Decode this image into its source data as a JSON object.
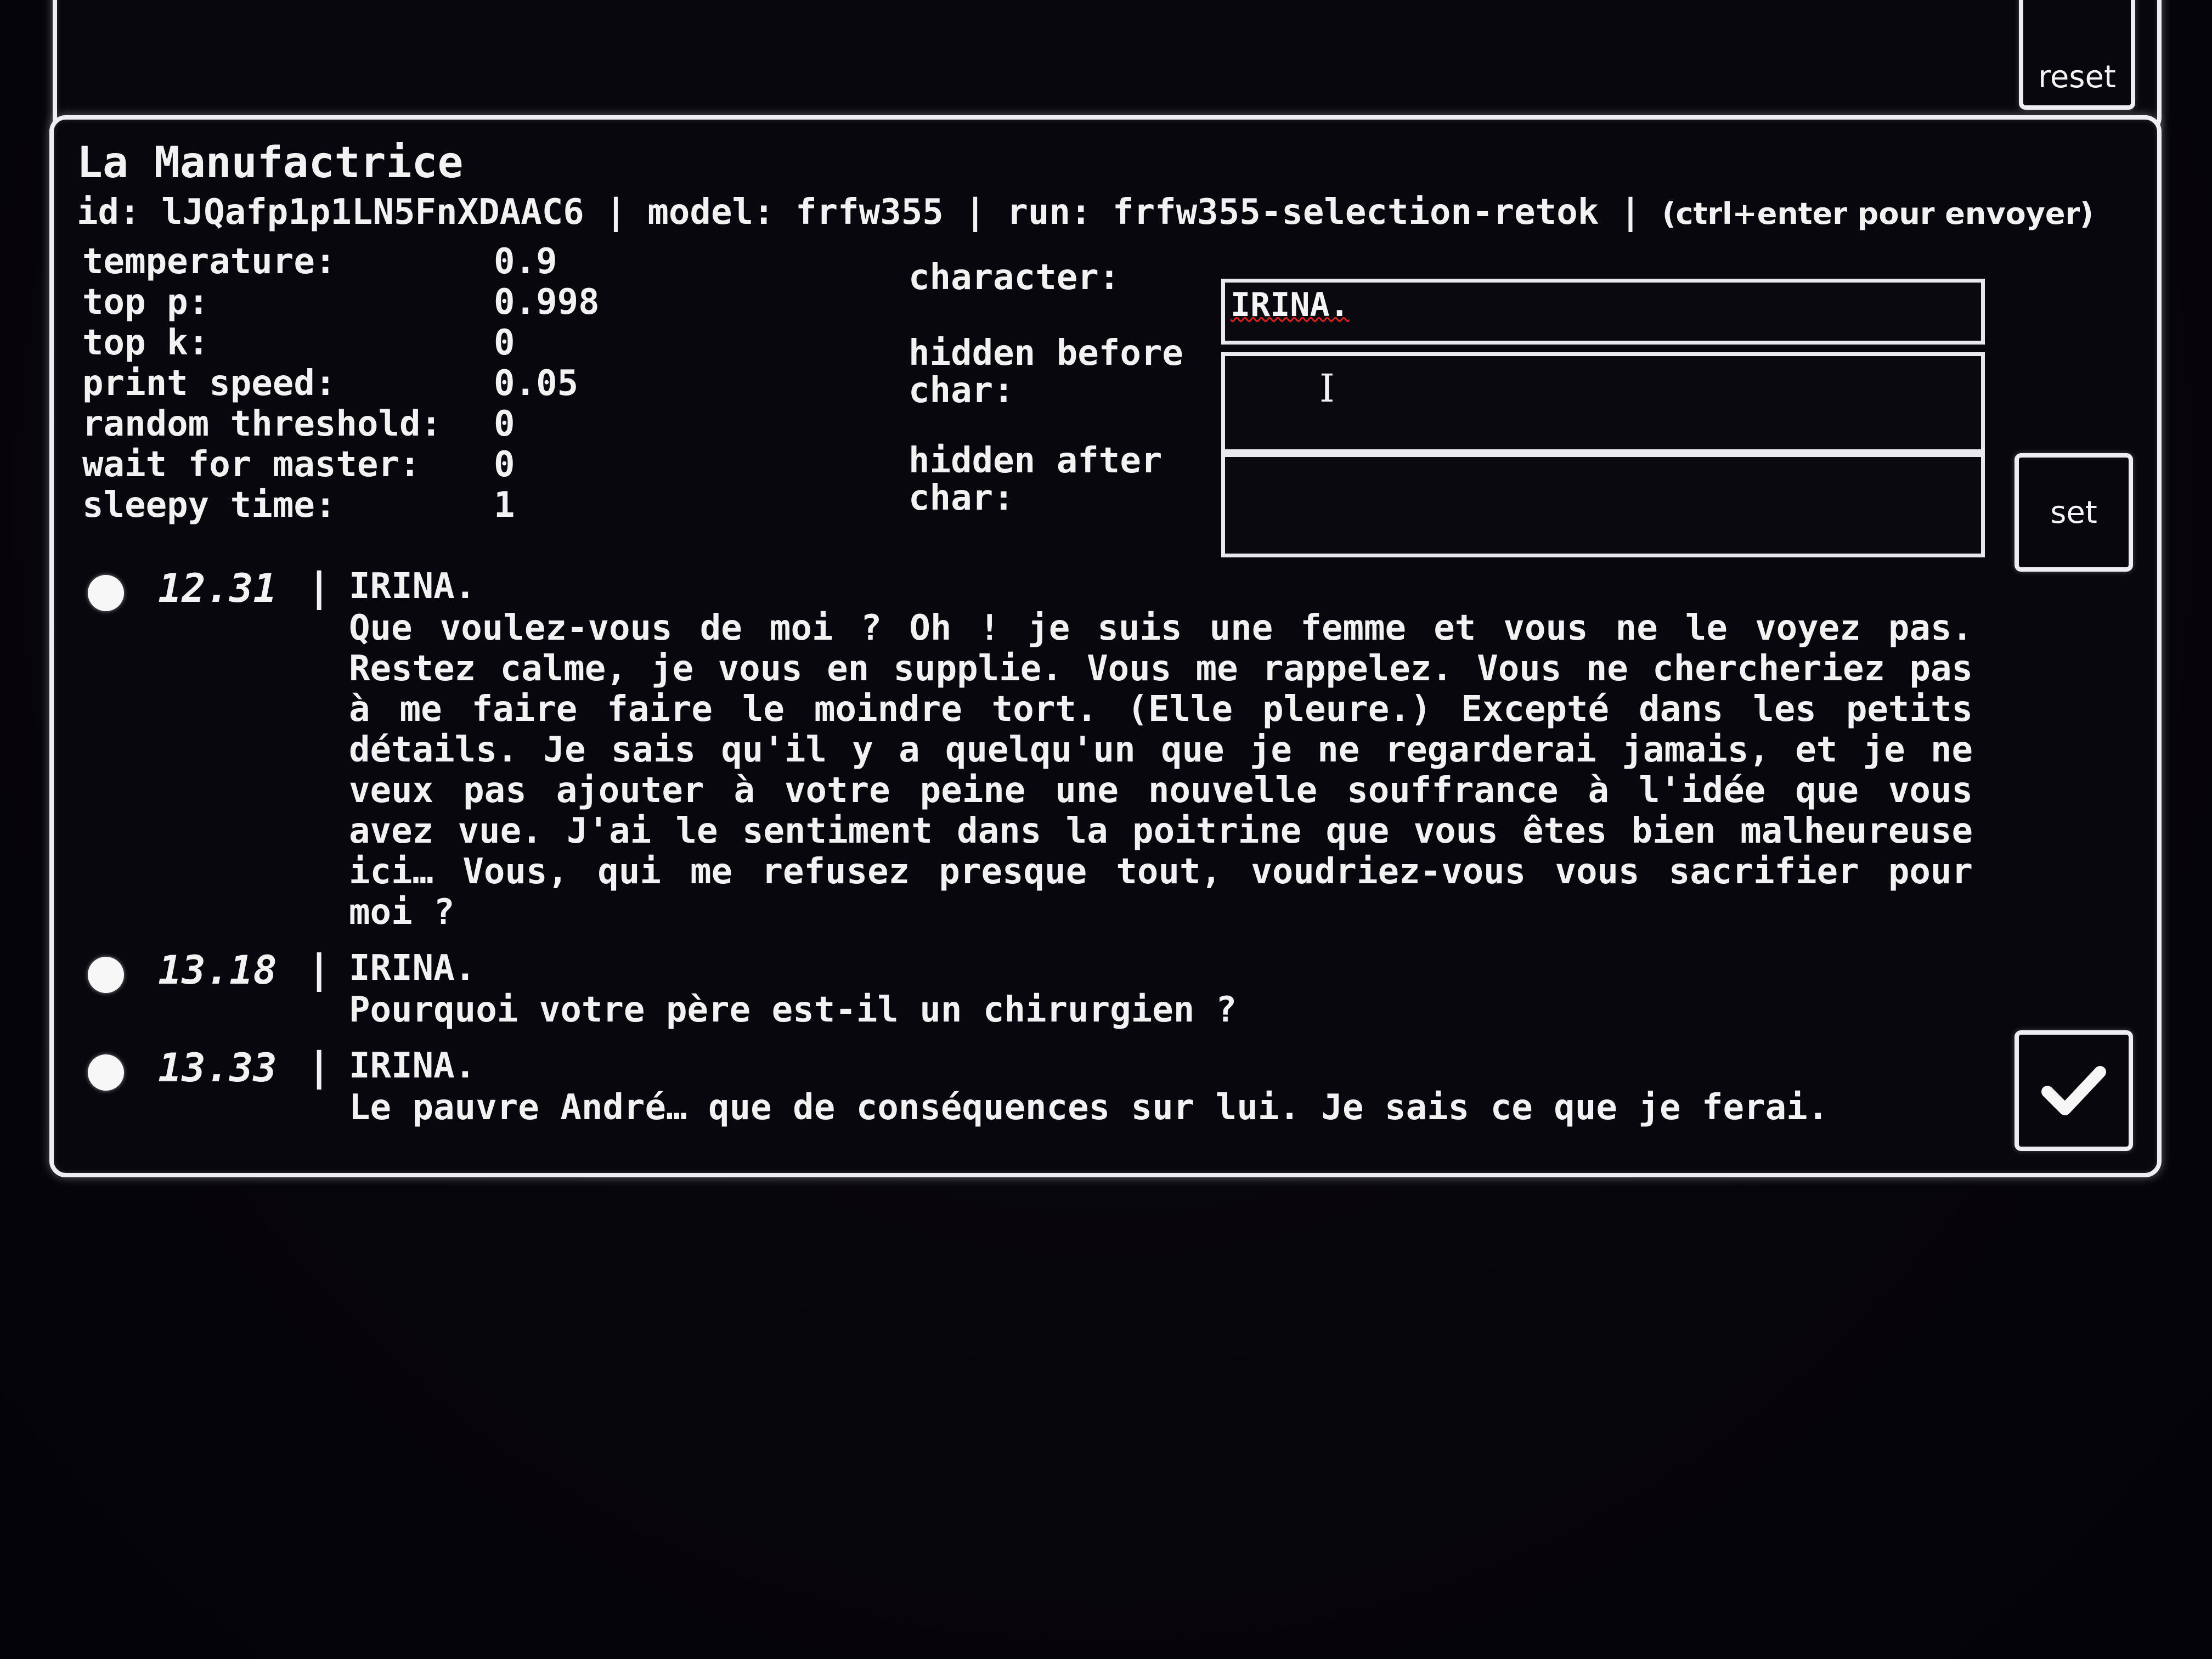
{
  "top_panel": {
    "reset_label": "reset"
  },
  "header": {
    "title": "La Manufactrice",
    "meta": "id: lJQafp1p1LN5FnXDAAC6 | model: frfw355 | run: frfw355-selection-retok | ",
    "hint": "(ctrl+enter pour envoyer)"
  },
  "params": [
    {
      "label": "temperature:",
      "value": "0.9"
    },
    {
      "label": "top p:",
      "value": "0.998"
    },
    {
      "label": "top k:",
      "value": "0"
    },
    {
      "label": "print speed:",
      "value": "0.05"
    },
    {
      "label": "random threshold:",
      "value": "0"
    },
    {
      "label": "wait for master:",
      "value": "0"
    },
    {
      "label": "sleepy time:",
      "value": "1"
    }
  ],
  "fields": {
    "character": {
      "label": "character:",
      "value": "IRINA."
    },
    "hidden_before": {
      "label": "hidden before\nchar:",
      "value": ""
    },
    "hidden_after": {
      "label": "hidden after\nchar:",
      "value": ""
    }
  },
  "set_label": "set",
  "messages": [
    {
      "time": "12.31",
      "separator": "|",
      "speaker": "IRINA.",
      "text": "Que voulez-vous de moi ? Oh ! je suis une femme et vous ne le voyez pas. Restez calme, je vous en supplie. Vous me rappelez. Vous ne chercheriez pas à me faire faire le moindre tort. (Elle pleure.) Excepté dans les petits détails. Je sais qu'il y a quelqu'un que je ne regarderai jamais, et je ne veux pas ajouter à votre peine une nouvelle souffrance à l'idée que vous avez vue. J'ai le sentiment dans la poitrine que vous êtes bien malheureuse ici… Vous, qui me refusez presque tout, voudriez-vous vous sacrifier pour moi ?"
    },
    {
      "time": "13.18",
      "separator": "|",
      "speaker": "IRINA.",
      "text": "Pourquoi votre père est-il un chirurgien ?"
    },
    {
      "time": "13.33",
      "separator": "|",
      "speaker": "IRINA.",
      "text": "Le pauvre André… que de conséquences sur lui. Je sais ce que je ferai."
    }
  ],
  "icons": {
    "confirm": "checkmark-icon",
    "message_marker": "dot-icon",
    "text_cursor": "i-beam-cursor-icon"
  },
  "colors": {
    "background": "#050409",
    "foreground": "#f2f2f2",
    "border": "#eeeef2",
    "spellcheck": "#d22222"
  }
}
